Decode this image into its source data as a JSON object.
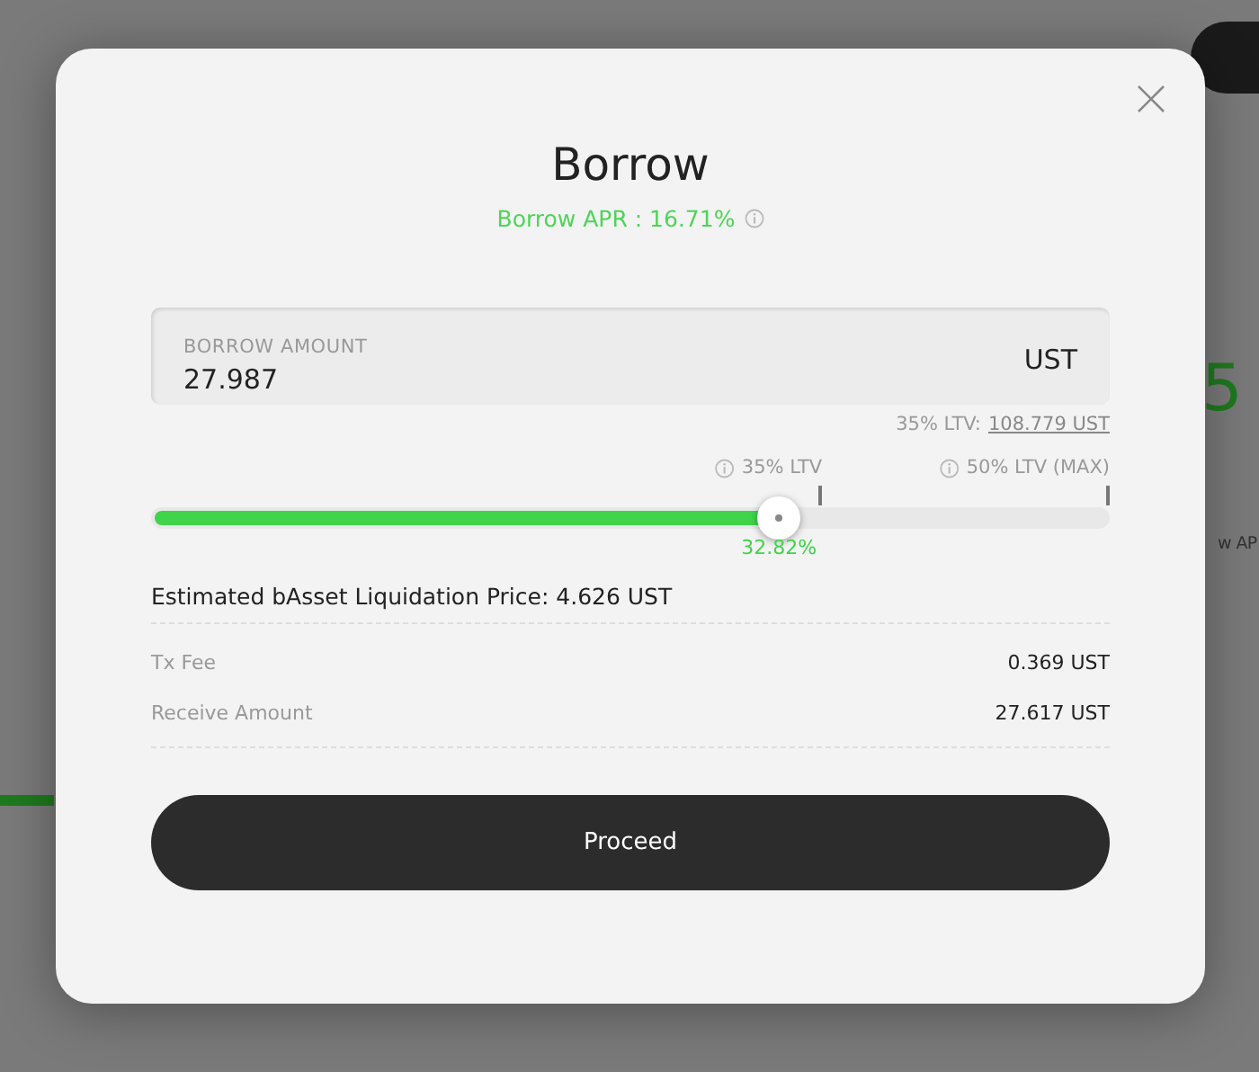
{
  "background": {
    "big_value": "5",
    "label_fragment": "w AP"
  },
  "dialog": {
    "title": "Borrow",
    "apr": "Borrow APR : 16.71%",
    "amount_field": {
      "label": "BORROW AMOUNT",
      "value": "27.987",
      "unit": "UST"
    },
    "ltv_hint": {
      "label": "35% LTV:",
      "link": "108.779 UST"
    },
    "slider": {
      "level": 0.655,
      "reading": "32.82%",
      "markers": [
        {
          "label": "35% LTV"
        },
        {
          "label": "50% LTV (MAX)"
        }
      ]
    },
    "liquidation_price": "Estimated bAsset Liquidation Price: 4.626 UST",
    "details": [
      {
        "label": "Tx Fee",
        "value": "0.369 UST"
      },
      {
        "label": "Receive Amount",
        "value": "27.617 UST"
      }
    ],
    "proceed_button": "Proceed"
  }
}
